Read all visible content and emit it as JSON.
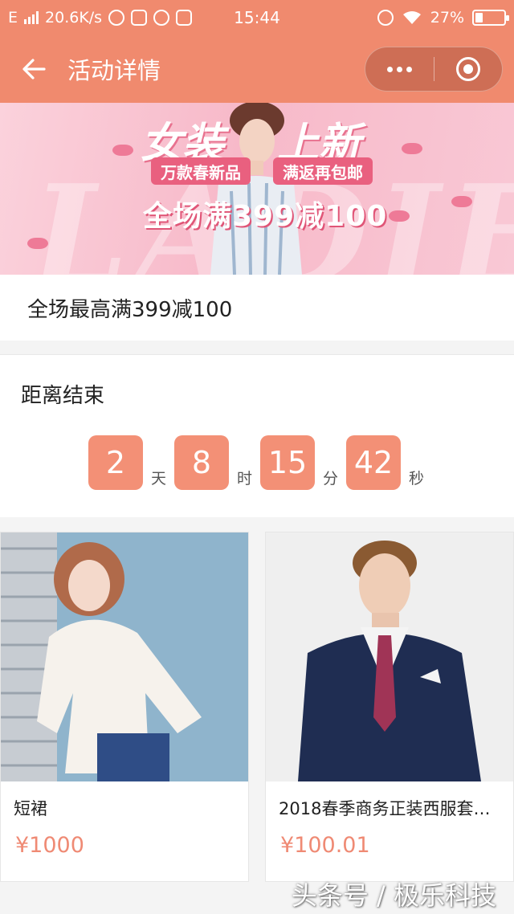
{
  "status_bar": {
    "network": "E",
    "speed": "20.6K/s",
    "time": "15:44",
    "battery_percent": "27%",
    "battery_level": 0.27
  },
  "nav": {
    "title": "活动详情"
  },
  "banner": {
    "headline_left": "女装",
    "headline_right": "上新",
    "tag_left": "万款春新品",
    "tag_right": "满返再包邮",
    "promo": "全场满399减100",
    "bg_text": "LADIES"
  },
  "activity": {
    "name": "全场最高满399减100"
  },
  "countdown": {
    "label": "距离结束",
    "days": "2",
    "days_unit": "天",
    "hours": "8",
    "hours_unit": "时",
    "minutes": "15",
    "minutes_unit": "分",
    "seconds": "42",
    "seconds_unit": "秒"
  },
  "products": [
    {
      "name": "短裙",
      "price": "¥1000"
    },
    {
      "name": "2018春季商务正装西服套…",
      "price": "¥100.01"
    }
  ],
  "watermark": "头条号 / 极乐科技",
  "colors": {
    "accent": "#f08a6e",
    "timer_box": "#f39076",
    "price": "#ef8a74"
  }
}
